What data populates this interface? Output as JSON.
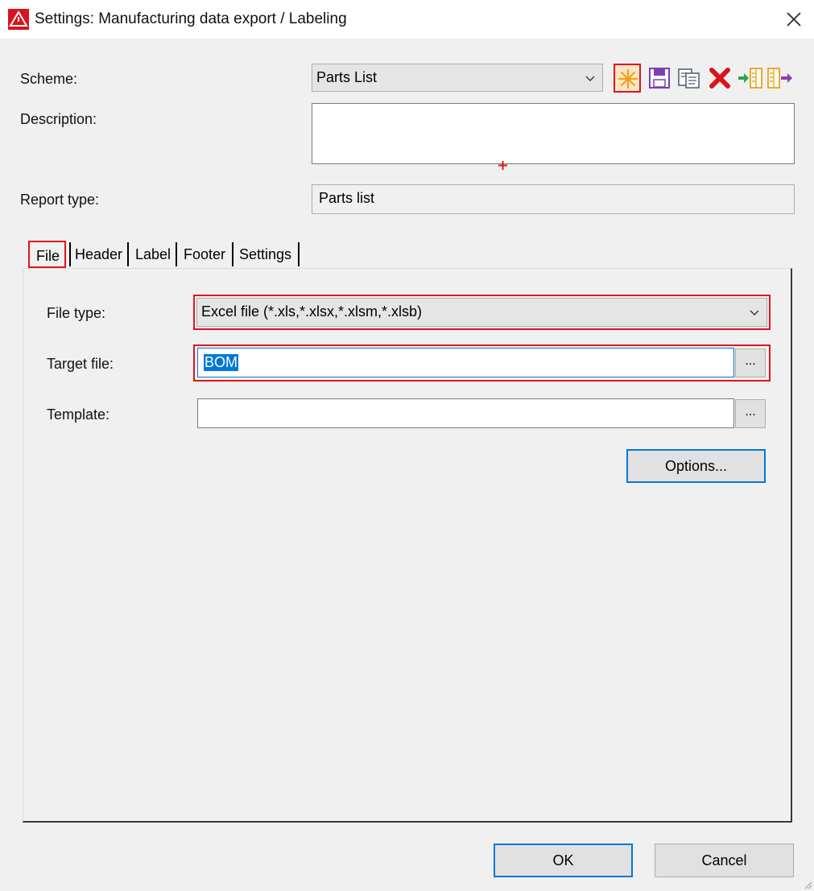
{
  "window": {
    "title": "Settings: Manufacturing data export / Labeling",
    "app_icon": "app-warning-logo-icon",
    "close_icon": "close-icon"
  },
  "form": {
    "scheme_label": "Scheme:",
    "scheme_value": "Parts List",
    "description_label": "Description:",
    "description_value": "",
    "report_type_label": "Report type:",
    "report_type_value": "Parts list"
  },
  "toolbar": [
    {
      "name": "new-scheme-icon",
      "highlighted": true
    },
    {
      "name": "save-scheme-icon"
    },
    {
      "name": "copy-scheme-icon"
    },
    {
      "name": "delete-scheme-icon"
    },
    {
      "name": "import-scheme-icon"
    },
    {
      "name": "export-scheme-icon"
    }
  ],
  "tabs": [
    {
      "label": "File",
      "active": true
    },
    {
      "label": "Header"
    },
    {
      "label": "Label"
    },
    {
      "label": "Footer"
    },
    {
      "label": "Settings"
    }
  ],
  "file_tab": {
    "file_type_label": "File type:",
    "file_type_value": "Excel file (*.xls,*.xlsx,*.xlsm,*.xlsb)",
    "target_file_label": "Target file:",
    "target_file_value": "BOM",
    "template_label": "Template:",
    "template_value": "",
    "browse_label": "...",
    "options_label": "Options..."
  },
  "buttons": {
    "ok": "OK",
    "cancel": "Cancel"
  },
  "colors": {
    "highlight_red": "#e0141e",
    "selection_blue": "#0078d7",
    "dialog_bg": "#f0f0f0"
  }
}
